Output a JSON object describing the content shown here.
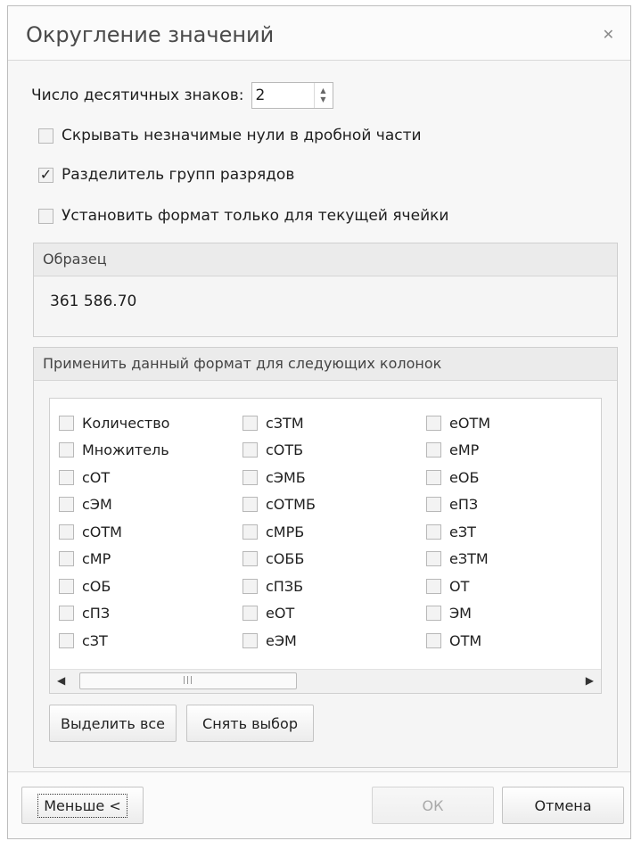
{
  "dialog": {
    "title": "Округление значений",
    "close_glyph": "✕"
  },
  "decimal": {
    "label": "Число десятичных знаков:",
    "value": "2"
  },
  "options": [
    {
      "label": "Скрывать незначимые нули в дробной части",
      "checked": false
    },
    {
      "label": "Разделитель групп разрядов",
      "checked": true
    },
    {
      "label": "Установить формат только для текущей ячейки",
      "checked": false
    }
  ],
  "sample": {
    "header": "Образец",
    "value": "361 586.70"
  },
  "columns_group": {
    "header": "Применить данный формат для следующих колонок",
    "columns": [
      [
        "Количество",
        "Множитель",
        "сОТ",
        "сЭМ",
        "сОТМ",
        "сМР",
        "сОБ",
        "сПЗ",
        "сЗТ"
      ],
      [
        "сЗТМ",
        "сОТБ",
        "сЭМБ",
        "сОТМБ",
        "сМРБ",
        "сОББ",
        "сПЗБ",
        "еОТ",
        "еЭМ"
      ],
      [
        "еОТМ",
        "еМР",
        "еОБ",
        "еПЗ",
        "еЗТ",
        "еЗТМ",
        "ОТ",
        "ЭМ",
        "ОТМ"
      ]
    ],
    "select_all": "Выделить все",
    "clear_selection": "Снять выбор"
  },
  "footer": {
    "less_button": "Меньше <",
    "ok_button": "ОК",
    "cancel_button": "Отмена"
  },
  "icons": {
    "close": "close-icon",
    "checkbox_checked": "checkmark-icon",
    "spin_up": "chevron-up-icon",
    "spin_down": "chevron-down-icon",
    "scroll_left": "arrow-left-icon",
    "scroll_right": "arrow-right-icon"
  }
}
